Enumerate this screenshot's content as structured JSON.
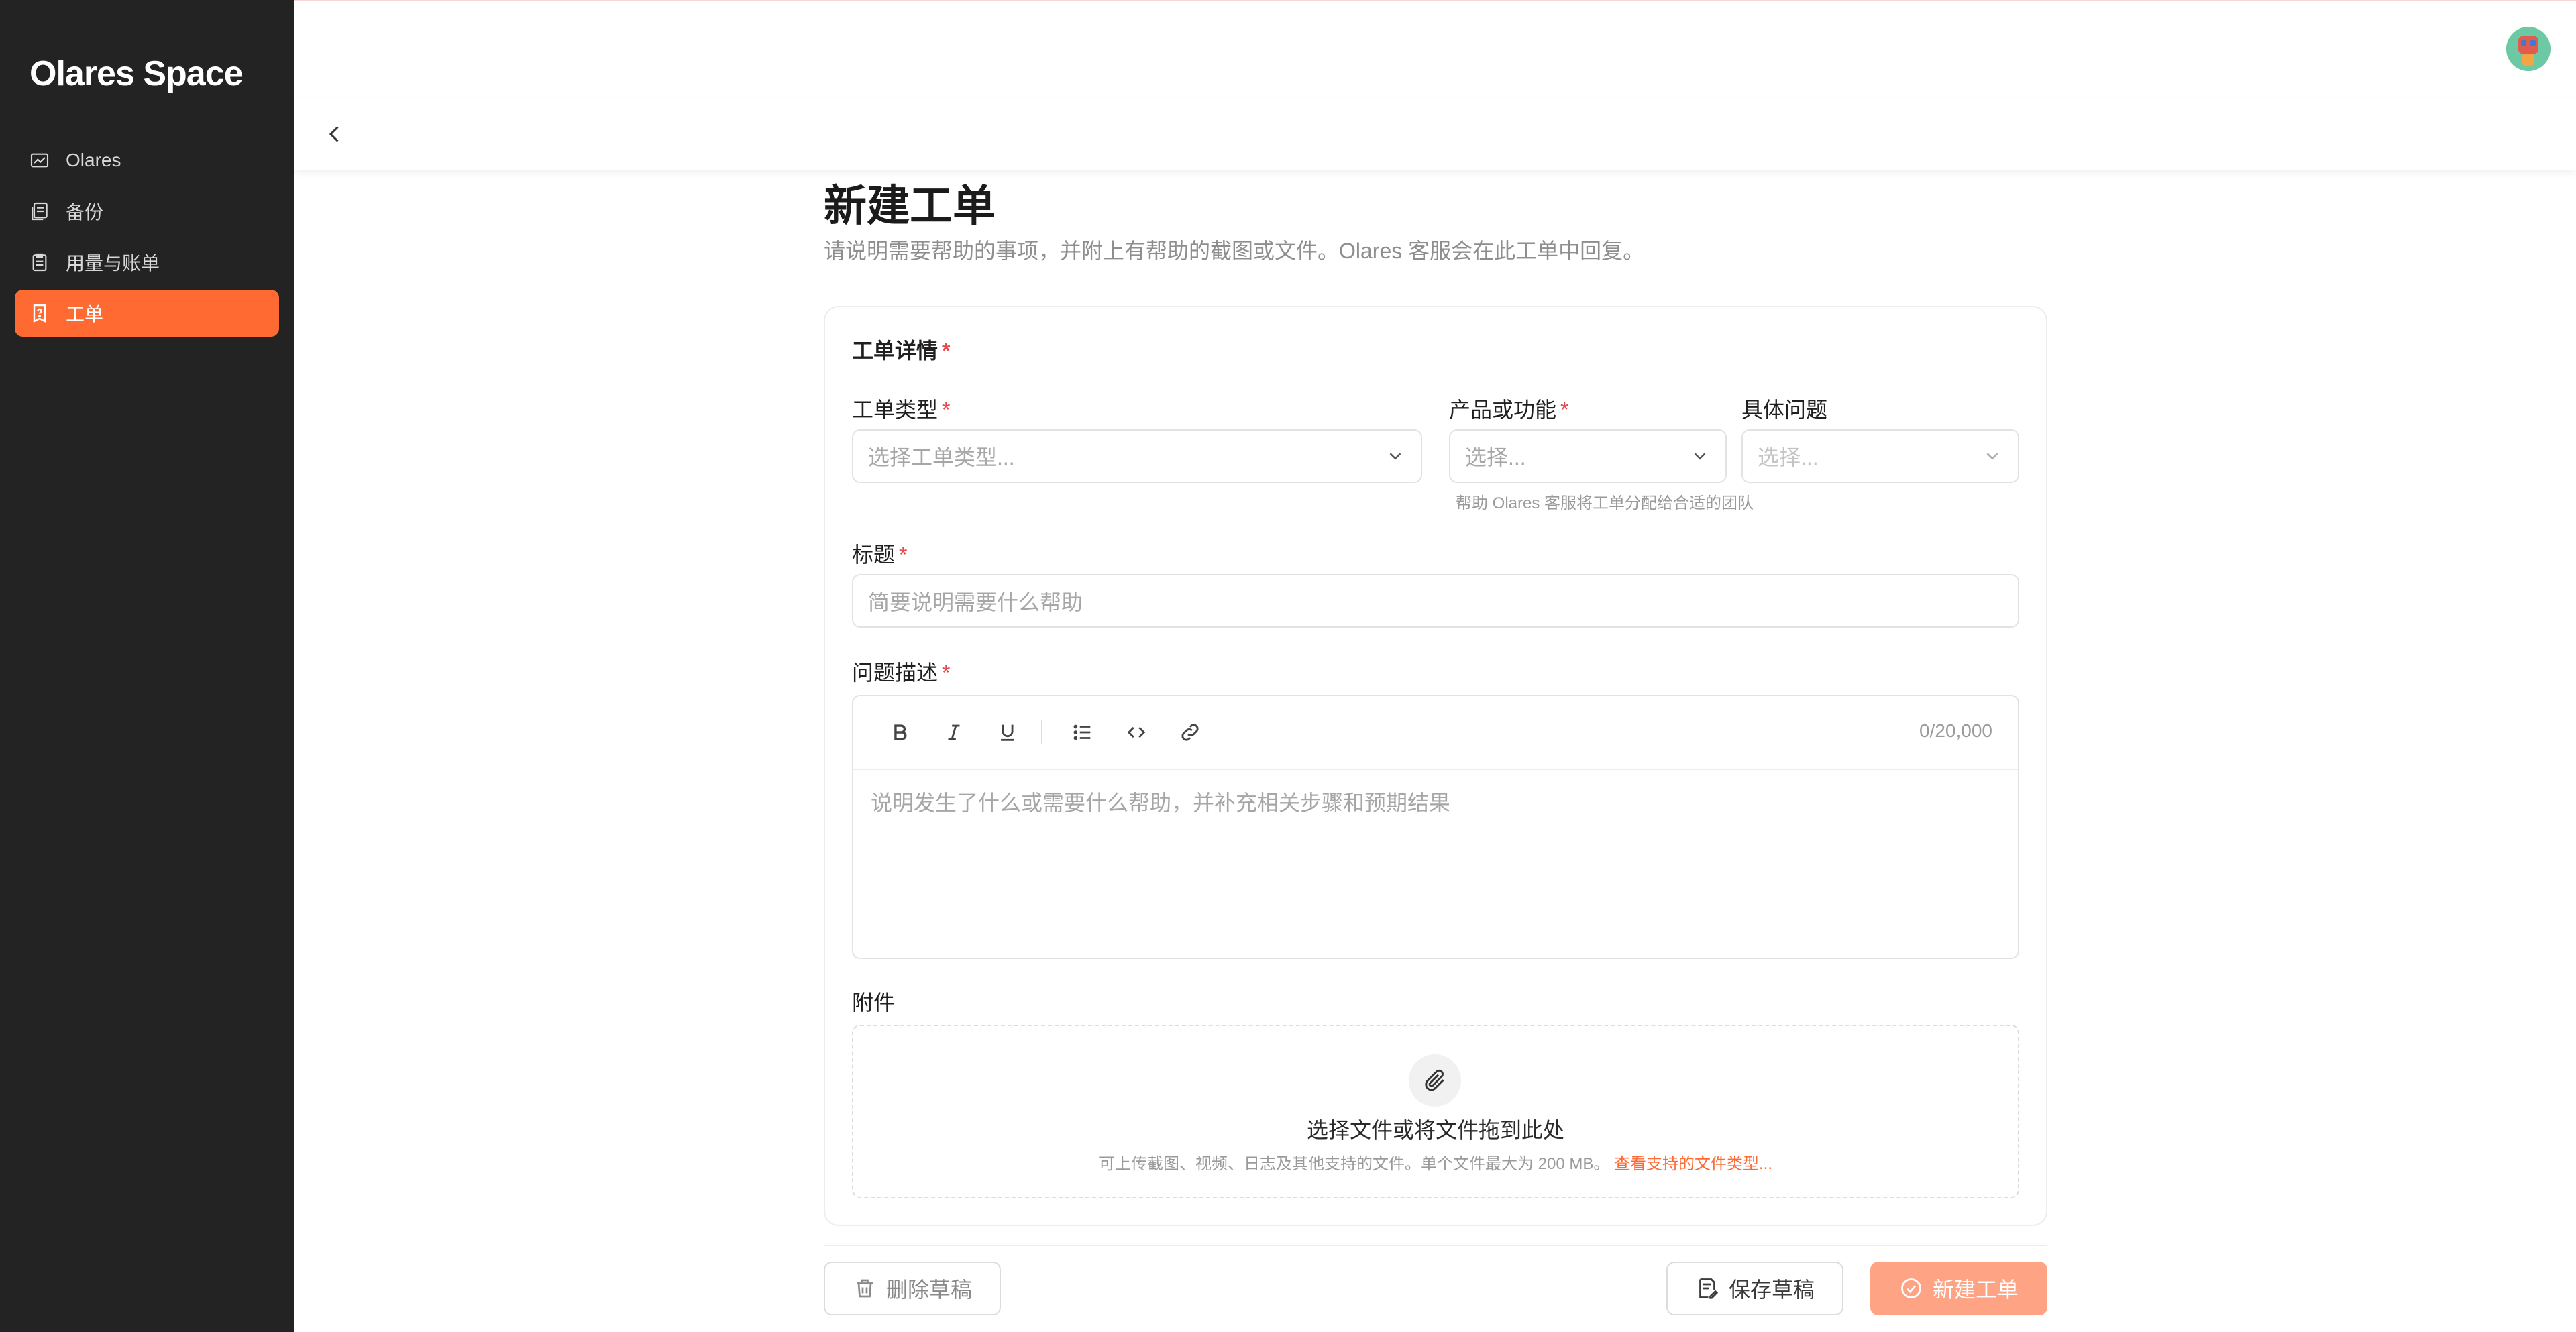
{
  "brand": "Olares Space",
  "sidebar": {
    "items": [
      {
        "label": "Olares",
        "icon": "chart-icon"
      },
      {
        "label": "备份",
        "icon": "backup-icon"
      },
      {
        "label": "用量与账单",
        "icon": "billing-icon"
      },
      {
        "label": "工单",
        "icon": "ticket-icon",
        "active": true
      }
    ]
  },
  "page": {
    "title": "新建工单",
    "subtitle": "请说明需要帮助的事项，并附上有帮助的截图或文件。Olares 客服会在此工单中回复。"
  },
  "form": {
    "section_title": "工单详情",
    "required_mark": "*",
    "ticket_type": {
      "label": "工单类型",
      "placeholder": "选择工单类型..."
    },
    "product": {
      "label": "产品或功能",
      "placeholder": "选择..."
    },
    "issue": {
      "label": "具体问题",
      "placeholder": "选择..."
    },
    "routing_hint": "帮助 Olares 客服将工单分配给合适的团队",
    "subject": {
      "label": "标题",
      "placeholder": "简要说明需要什么帮助"
    },
    "description": {
      "label": "问题描述",
      "placeholder": "说明发生了什么或需要什么帮助，并补充相关步骤和预期结果",
      "counter": "0/20,000",
      "toolbar": [
        "bold-icon",
        "italic-icon",
        "underline-icon",
        "bullet-list-icon",
        "code-icon",
        "link-icon"
      ]
    },
    "attachments": {
      "label": "附件",
      "title": "选择文件或将文件拖到此处",
      "hint": "可上传截图、视频、日志及其他支持的文件。单个文件最大为 200 MB。",
      "link": "查看支持的文件类型..."
    }
  },
  "actions": {
    "delete_draft": "删除草稿",
    "save_draft": "保存草稿",
    "submit": "新建工单"
  },
  "colors": {
    "accent": "#ff6a33",
    "sidebar_bg": "#232323",
    "submit_bg": "#ffa385",
    "required": "#e5484d"
  }
}
